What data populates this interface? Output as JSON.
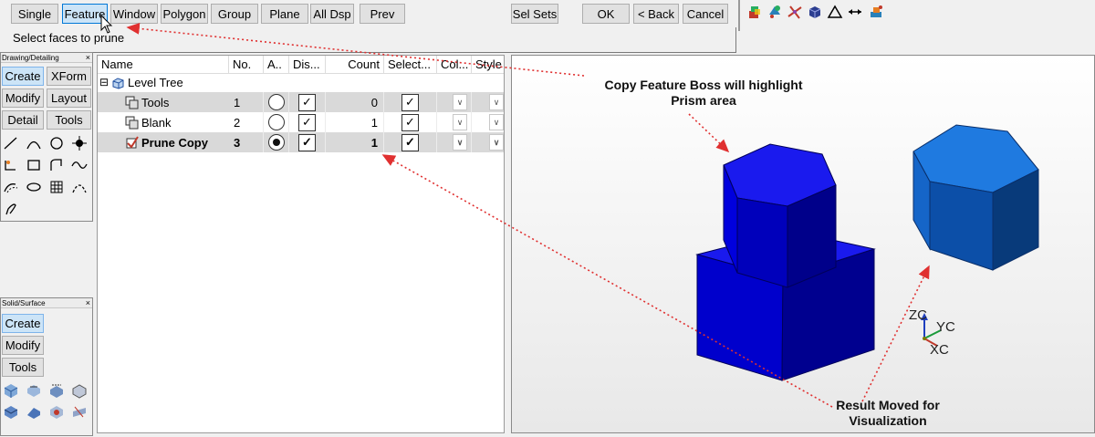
{
  "toolbar": {
    "single": "Single",
    "feature": "Feature",
    "window": "Window",
    "polygon": "Polygon",
    "group": "Group",
    "plane": "Plane",
    "all_dsp": "All Dsp",
    "prev": "Prev",
    "sel_sets": "Sel Sets",
    "ok": "OK",
    "back": "< Back",
    "cancel": "Cancel"
  },
  "prompt": "Select faces to prune",
  "palette1": {
    "title": "Drawing/Detailing",
    "close": "×",
    "create": "Create",
    "xform": "XForm",
    "modify": "Modify",
    "layout": "Layout",
    "detail": "Detail",
    "tools": "Tools"
  },
  "palette2": {
    "title": "Solid/Surface",
    "close": "×",
    "create": "Create",
    "modify": "Modify",
    "tools": "Tools"
  },
  "tree": {
    "columns": {
      "name": "Name",
      "no": "No.",
      "active": "A..",
      "display": "Dis...",
      "count": "Count",
      "select": "Select...",
      "color": "Col...",
      "style": "Style"
    },
    "root": "Level Tree",
    "root_expander": "⊟",
    "rows": [
      {
        "name": "Tools",
        "no": "1",
        "count": "0",
        "active": false,
        "bold": false
      },
      {
        "name": "Blank",
        "no": "2",
        "count": "1",
        "active": false,
        "bold": false
      },
      {
        "name": "Prune Copy",
        "no": "3",
        "count": "1",
        "active": true,
        "bold": true
      }
    ],
    "check_glyph": "✓",
    "dropdown_glyph": "∨"
  },
  "viewport": {
    "callout_top": "Copy Feature Boss will highlight Prism area",
    "callout_bottom": "Result Moved for Visualization",
    "axis": {
      "z": "ZC",
      "y": "YC",
      "x": "XC"
    }
  },
  "colors": {
    "solid_top": "#1a1aee",
    "solid_front": "#0000cc",
    "solid_side": "#00008f",
    "result_top": "#1f7ae0",
    "result_front": "#0c4fa8",
    "result_side": "#083a7a",
    "arrow": "#e03030",
    "selection_row": "#d9d9d9",
    "active_button": "#cce4f7"
  }
}
